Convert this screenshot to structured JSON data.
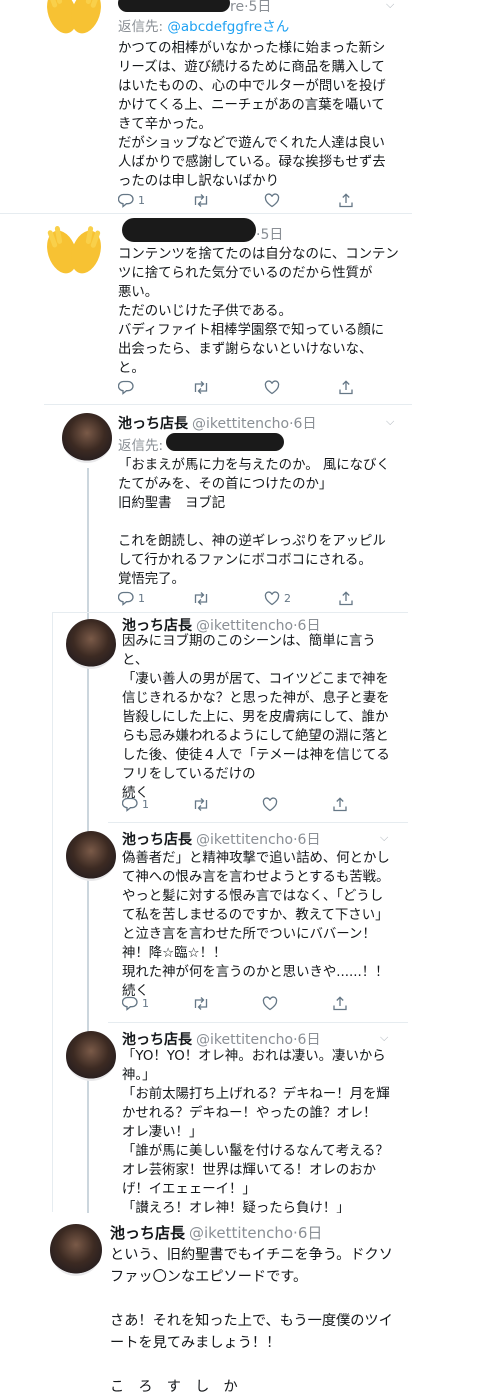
{
  "tweets": [
    {
      "handle_tail": "re",
      "time": "5日",
      "reply_label": "返信先:",
      "reply_handle": "@abcdefggfreさん",
      "body": "かつての相棒がいなかった様に始まった新シ\nリーズは、遊び続けるために商品を購入して\nはいたものの、心の中でルターが問いを投げ\nかけてくる上、ニーチェがあの言葉を囁いて\nきて辛かった。\nだがショップなどで遊んでくれた人達は良い\n人ばかりで感謝している。碌な挨拶もせず去\nったのは申し訳ないばかり",
      "reply_count": "1",
      "retweet_count": "",
      "like_count": ""
    },
    {
      "time": "5日",
      "body": "コンテンツを捨てたのは自分なのに、コンテン\nツに捨てられた気分でいるのだから性質が\n悪い。\nただのいじけた子供である。\nバディファイト相棒学園祭で知っている顔に\n出会ったら、まず謝らないといけないな、\nと。",
      "reply_count": "",
      "retweet_count": "",
      "like_count": ""
    },
    {
      "name": "池っち店長",
      "handle": "@ikettitencho",
      "time": "6日",
      "reply_label": "返信先:",
      "body": "「おまえが馬に力を与えたのか。 風になびく\nたてがみを、その首につけたのか」\n旧約聖書　ヨブ記\n\nこれを朗読し、神の逆ギレっぷりをアッピル\nして行かれるファンにボコボコにされる。\n覚悟完了。",
      "reply_count": "1",
      "retweet_count": "",
      "like_count": "2"
    },
    {
      "name": "池っち店長",
      "handle": "@ikettitencho",
      "time": "6日",
      "body": "因みにヨブ期のこのシーンは、簡単に言う\nと、\n「凄い善人の男が居て、コイツどこまで神を\n信じきれるかな？と思った神が、息子と妻を\n皆殺しにした上に、男を皮膚病にして、誰か\nらも忌み嫌われるようにして絶望の淵に落と\nした後、使徒４人で「テメーは神を信じてる\nフリをしているだけの\n続く",
      "reply_count": "1",
      "retweet_count": "",
      "like_count": ""
    },
    {
      "name": "池っち店長",
      "handle": "@ikettitencho",
      "time": "6日",
      "body": "偽善者だ」と精神攻撃で追い詰め、何とかし\nて神への恨み言を言わせようとするも苦戦。\nやっと髪に対する恨み言ではなく、「どうし\nて私を苦しませるのですか、教えて下さい」\nと泣き言を言わせた所でついにババーン！\n神！降☆臨☆！！\n現れた神が何を言うのかと思いきや......！！\n続く",
      "reply_count": "1",
      "retweet_count": "",
      "like_count": ""
    },
    {
      "name": "池っち店長",
      "handle": "@ikettitencho",
      "time": "6日",
      "body": "「YO！YO！オレ神。おれは凄い。凄いから\n神。」\n「お前太陽打ち上げれる？デキねー！月を輝\nかせれる？デキねー！やったの誰？オレ！\nオレ凄い！」\n「誰が馬に美しい鬣を付けるなんて考える？\nオレ芸術家！世界は輝いてる！オレのおか\nげ！イエェェーイ！」\n「讃えろ！オレ神！疑ったら負け！」\n続く"
    },
    {
      "name": "池っち店長",
      "handle": "@ikettitencho",
      "time": "6日",
      "body": "という、旧約聖書でもイチニを争う。ドクソ\nファッ〇ンなエピソードです。\n\nさあ！それを知った上で、もう一度僕のツイ\nートを見てみましょう！！\n\nこ　ろ　す　し　か"
    }
  ]
}
